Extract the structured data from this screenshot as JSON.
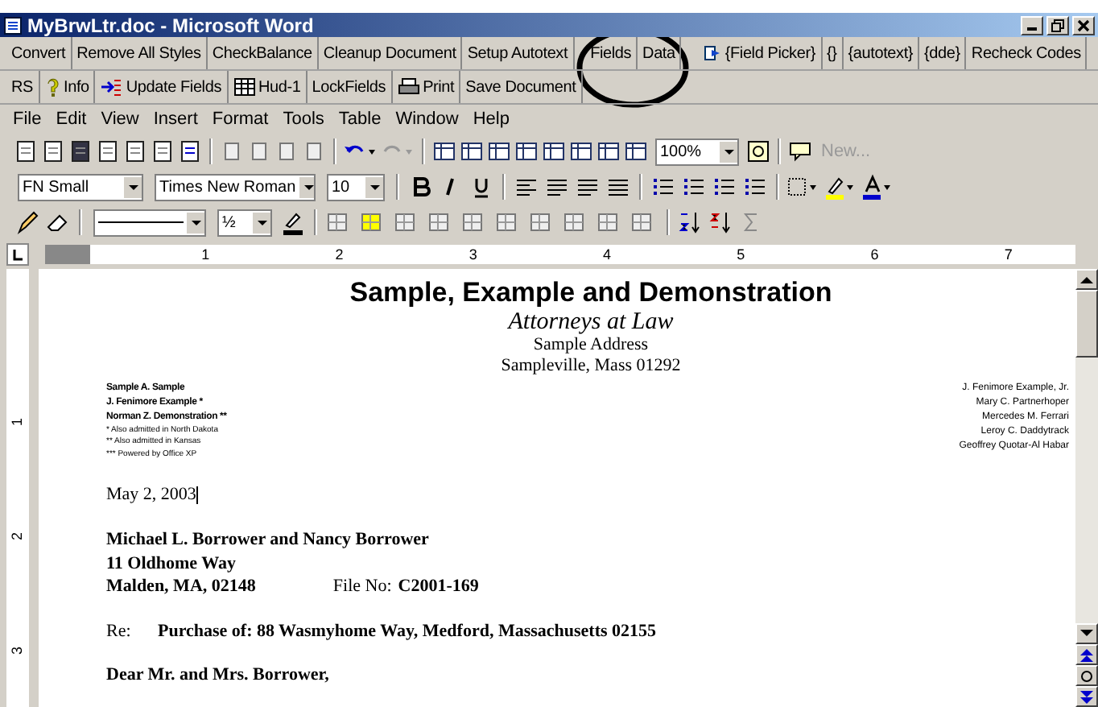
{
  "window": {
    "title": "MyBrwLtr.doc - Microsoft Word"
  },
  "custom_toolbar_1": [
    {
      "label": "Convert"
    },
    {
      "label": "Remove All Styles"
    },
    {
      "label": "CheckBalance"
    },
    {
      "label": "Cleanup Document"
    },
    {
      "label": "Setup Autotext"
    },
    {
      "label": "Fields"
    },
    {
      "label": "Data"
    },
    {
      "label": "{Field Picker}",
      "icon": true
    },
    {
      "label": "{}"
    },
    {
      "label": "{autotext}"
    },
    {
      "label": "{dde}"
    },
    {
      "label": "Recheck Codes"
    }
  ],
  "custom_toolbar_2": [
    {
      "label": "RS"
    },
    {
      "label": "Info",
      "icon": true
    },
    {
      "label": "Update Fields",
      "icon": true
    },
    {
      "label": "Hud-1",
      "icon": true
    },
    {
      "label": "LockFields"
    },
    {
      "label": "Print",
      "icon": true
    },
    {
      "label": "Save Document"
    }
  ],
  "menu": [
    "File",
    "Edit",
    "View",
    "Insert",
    "Format",
    "Tools",
    "Table",
    "Window",
    "Help"
  ],
  "standard_toolbar": {
    "zoom": "100%",
    "new_comment": "New..."
  },
  "formatting_toolbar": {
    "style": "FN Small",
    "font": "Times New Roman",
    "size": "10"
  },
  "drawing_toolbar": {
    "line_weight": "½"
  },
  "ruler": [
    "1",
    "2",
    "3",
    "4",
    "5",
    "6",
    "7"
  ],
  "vertical_ruler": [
    "1",
    "2",
    "3"
  ],
  "document": {
    "firm": "Sample, Example and Demonstration",
    "subtitle": "Attorneys at Law",
    "address": "Sample Address",
    "city": "Sampleville, Mass 01292",
    "left_names": [
      "Sample A. Sample",
      "J. Fenimore Example *",
      "Norman Z. Demonstration **"
    ],
    "notes": [
      "* Also admitted in North Dakota",
      "** Also admitted in Kansas",
      "*** Powered by Office XP"
    ],
    "right_names": [
      "J. Fenimore Example, Jr.",
      "Mary C. Partnerhoper",
      "Mercedes M. Ferrari",
      "Leroy C. Daddytrack",
      "Geoffrey Quotar-Al Habar"
    ],
    "date": "May 2, 2003",
    "recipient": [
      "Michael L. Borrower and Nancy Borrower",
      "11 Oldhome Way",
      "Malden, MA, 02148"
    ],
    "file_label": "File No:",
    "file_no": "C2001-169",
    "re_label": "Re:",
    "re_text": "Purchase of: 88 Wasmyhome Way, Medford, Massachusetts 02155",
    "salutation": "Dear Mr. and Mrs. Borrower,"
  }
}
